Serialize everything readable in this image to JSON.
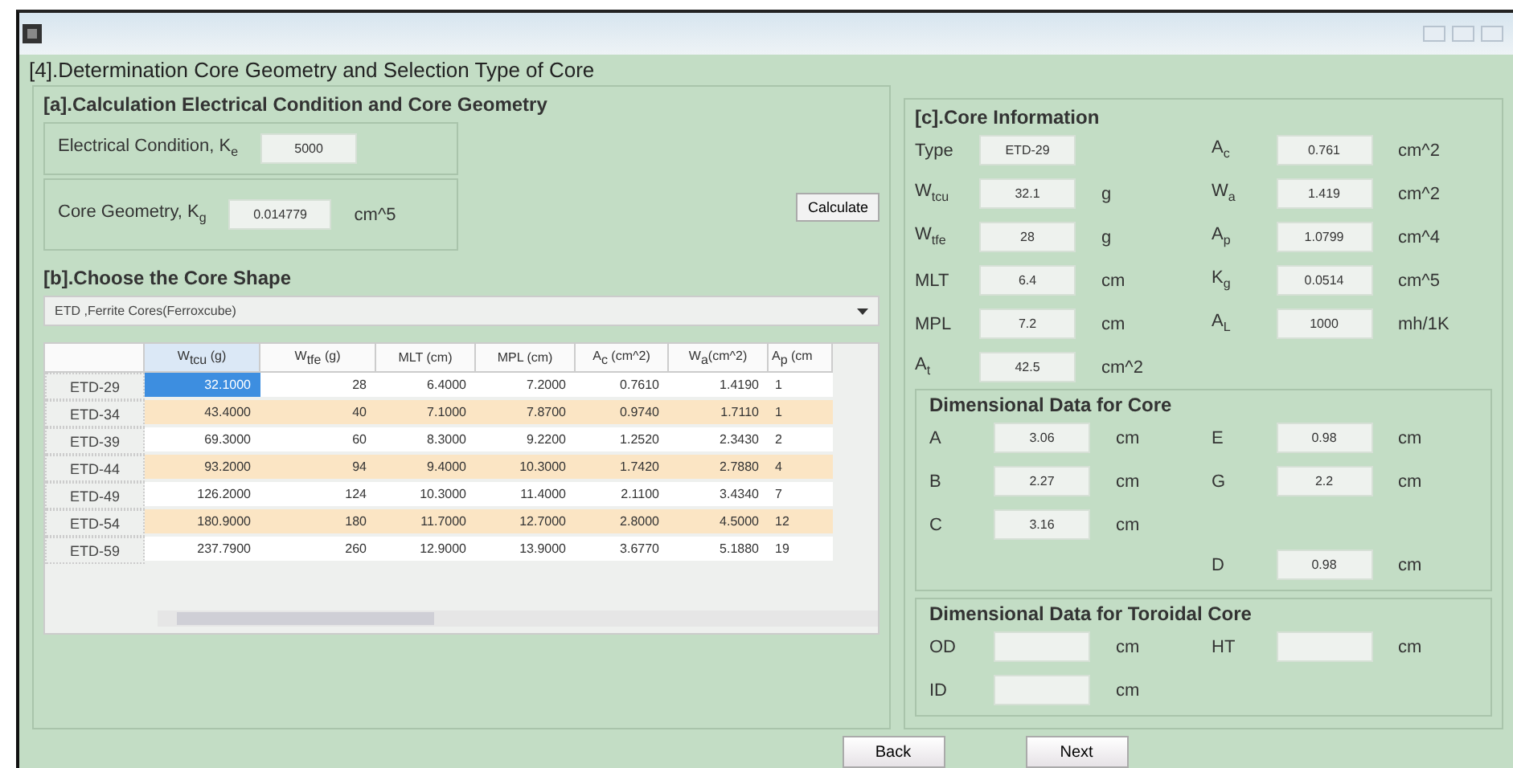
{
  "heading": "[4].Determination Core Geometry and Selection Type of Core",
  "section_a": {
    "title": "[a].Calculation Electrical Condition and Core Geometry",
    "electrical": {
      "label": "Electrical Condition, K$_{e}$",
      "value": "5000"
    },
    "geometry": {
      "label": "Core Geometry, K$_{g}$",
      "value": "0.014779",
      "unit": "cm^5"
    },
    "calculate": "Calculate"
  },
  "section_b": {
    "title": "[b].Choose the Core Shape",
    "dropdown": "ETD ,Ferrite Cores(Ferroxcube)",
    "columns": [
      "W$_{tcu}$ (g)",
      "W$_{tfe}$ (g)",
      "MLT (cm)",
      "MPL (cm)",
      "A$_{c}$ (cm^2)",
      "W$_{a}$(cm^2)",
      "A$_{p}$ (cm"
    ],
    "rows": [
      {
        "name": "ETD-29",
        "selected": true,
        "cells": [
          "32.1000",
          "28",
          "6.4000",
          "7.2000",
          "0.7610",
          "1.4190",
          "1"
        ]
      },
      {
        "name": "ETD-34",
        "selected": false,
        "cells": [
          "43.4000",
          "40",
          "7.1000",
          "7.8700",
          "0.9740",
          "1.7110",
          "1"
        ]
      },
      {
        "name": "ETD-39",
        "selected": false,
        "cells": [
          "69.3000",
          "60",
          "8.3000",
          "9.2200",
          "1.2520",
          "2.3430",
          "2"
        ]
      },
      {
        "name": "ETD-44",
        "selected": false,
        "cells": [
          "93.2000",
          "94",
          "9.4000",
          "10.3000",
          "1.7420",
          "2.7880",
          "4"
        ]
      },
      {
        "name": "ETD-49",
        "selected": false,
        "cells": [
          "126.2000",
          "124",
          "10.3000",
          "11.4000",
          "2.1100",
          "3.4340",
          "7"
        ]
      },
      {
        "name": "ETD-54",
        "selected": false,
        "cells": [
          "180.9000",
          "180",
          "11.7000",
          "12.7000",
          "2.8000",
          "4.5000",
          "12"
        ]
      },
      {
        "name": "ETD-59",
        "selected": false,
        "cells": [
          "237.7900",
          "260",
          "12.9000",
          "13.9000",
          "3.6770",
          "5.1880",
          "19"
        ]
      }
    ]
  },
  "section_c": {
    "title": "[c].Core Information",
    "left": [
      {
        "label": "Type",
        "value": "ETD-29"
      },
      {
        "label": "W$_{tcu}$",
        "value": "32.1",
        "unit": "g"
      },
      {
        "label": "W$_{tfe}$",
        "value": "28",
        "unit": "g"
      },
      {
        "label": "MLT",
        "value": "6.4",
        "unit": "cm"
      },
      {
        "label": "MPL",
        "value": "7.2",
        "unit": "cm"
      },
      {
        "label": "A$_{t}$",
        "value": "42.5",
        "unit": "cm^2"
      }
    ],
    "right": [
      {
        "label": "A$_{c}$",
        "value": "0.761",
        "unit": "cm^2"
      },
      {
        "label": "W$_{a}$",
        "value": "1.419",
        "unit": "cm^2"
      },
      {
        "label": "A$_{p}$",
        "value": "1.0799",
        "unit": "cm^4"
      },
      {
        "label": "K$_{g}$",
        "value": "0.0514",
        "unit": "cm^5"
      },
      {
        "label": "A$_{L}$",
        "value": "1000",
        "unit": "mh/1K"
      }
    ]
  },
  "dimensional": {
    "title": "Dimensional Data for Core",
    "left": [
      {
        "label": "A",
        "value": "3.06",
        "unit": "cm"
      },
      {
        "label": "B",
        "value": "2.27",
        "unit": "cm"
      },
      {
        "label": "C",
        "value": "3.16",
        "unit": "cm"
      }
    ],
    "right": [
      {
        "label": "E",
        "value": "0.98",
        "unit": "cm"
      },
      {
        "label": "G",
        "value": "2.2",
        "unit": "cm"
      },
      {
        "label": "D",
        "value": "0.98",
        "unit": "cm"
      }
    ]
  },
  "toroidal": {
    "title": "Dimensional Data for Toroidal Core",
    "left": [
      {
        "label": "OD",
        "unit": "cm"
      },
      {
        "label": "ID",
        "unit": "cm"
      }
    ],
    "right": [
      {
        "label": "HT",
        "unit": "cm"
      }
    ]
  },
  "buttons": [
    "Back",
    "Next"
  ]
}
